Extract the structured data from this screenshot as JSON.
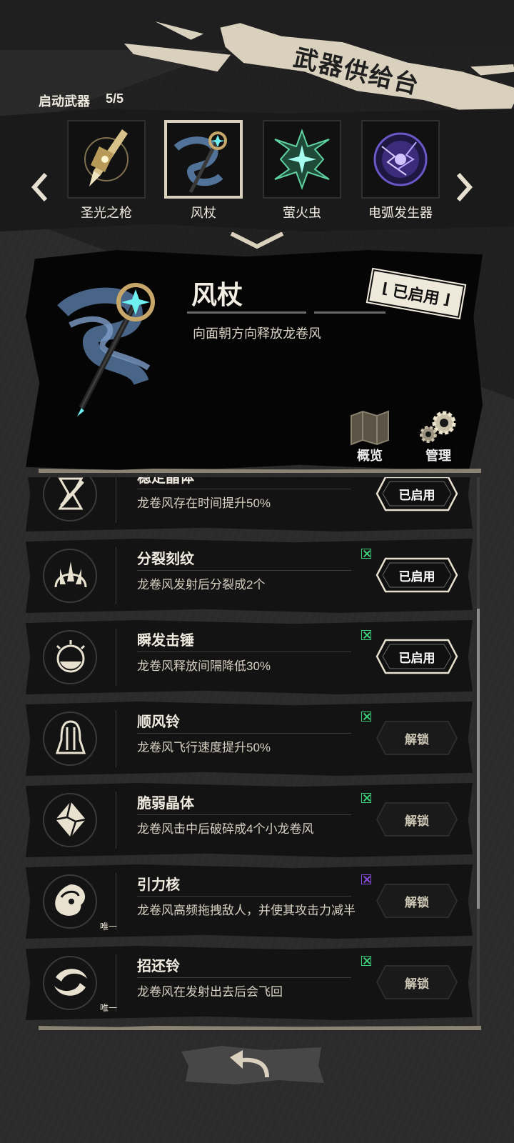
{
  "header": {
    "title": "武器供给台",
    "active_weapons_label": "启动武器",
    "active_weapons_count": "5/5"
  },
  "weapons": [
    {
      "name": "圣光之枪",
      "icon": "holy-lance-icon",
      "selected": false
    },
    {
      "name": "风杖",
      "icon": "wind-staff-icon",
      "selected": true
    },
    {
      "name": "萤火虫",
      "icon": "firefly-icon",
      "selected": false
    },
    {
      "name": "电弧发生器",
      "icon": "arc-generator-icon",
      "selected": false
    }
  ],
  "detail": {
    "name": "风杖",
    "description": "向面朝方向释放龙卷风",
    "status_stamp": "已启用",
    "overview_label": "概览",
    "manage_label": "管理"
  },
  "upgrades": [
    {
      "name": "稳定晶体",
      "desc": "龙卷风存在时间提升50%",
      "button": "已启用",
      "state": "enabled",
      "rarity": "green",
      "icon": "hourglass-sword-icon",
      "unique": ""
    },
    {
      "name": "分裂刻纹",
      "desc": "龙卷风发射后分裂成2个",
      "button": "已启用",
      "state": "enabled",
      "rarity": "green",
      "icon": "split-crown-icon",
      "unique": ""
    },
    {
      "name": "瞬发击锤",
      "desc": "龙卷风释放间隔降低30%",
      "button": "已启用",
      "state": "enabled",
      "rarity": "green",
      "icon": "hammer-clock-icon",
      "unique": ""
    },
    {
      "name": "顺风铃",
      "desc": "龙卷风飞行速度提升50%",
      "button": "解锁",
      "state": "locked",
      "rarity": "green",
      "icon": "bell-icon",
      "unique": ""
    },
    {
      "name": "脆弱晶体",
      "desc": "龙卷风击中后破碎成4个小龙卷风",
      "button": "解锁",
      "state": "locked",
      "rarity": "green",
      "icon": "shattered-crystal-icon",
      "unique": ""
    },
    {
      "name": "引力核",
      "desc": "龙卷风高频拖拽敌人，并使其攻击力减半",
      "button": "解锁",
      "state": "locked",
      "rarity": "purple",
      "icon": "vortex-core-icon",
      "unique": "唯一"
    },
    {
      "name": "招还铃",
      "desc": "龙卷风在发射出去后会飞回",
      "button": "解锁",
      "state": "locked",
      "rarity": "green",
      "icon": "boomerang-swirl-icon",
      "unique": "唯一"
    }
  ],
  "colors": {
    "paper": "#d9d0bd",
    "rarity_green": "#3fd17a",
    "rarity_purple": "#8a4fe0",
    "panel_dark": "#050505"
  }
}
